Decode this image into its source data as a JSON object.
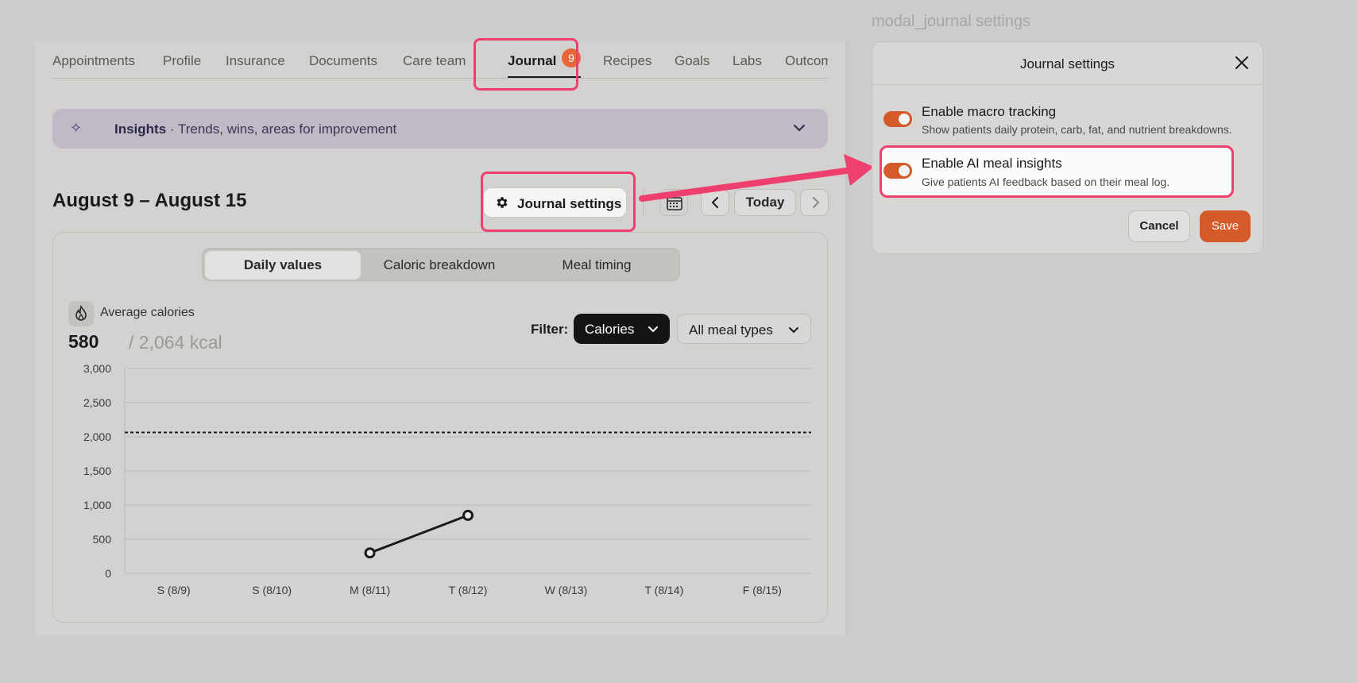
{
  "tabs": [
    {
      "label": "Appointments"
    },
    {
      "label": "Profile"
    },
    {
      "label": "Insurance"
    },
    {
      "label": "Documents"
    },
    {
      "label": "Care team"
    },
    {
      "label": "Journal",
      "badge": "9"
    },
    {
      "label": "Recipes"
    },
    {
      "label": "Goals"
    },
    {
      "label": "Labs"
    },
    {
      "label": "Outcomes"
    }
  ],
  "insights": {
    "bold": "Insights",
    "rest": " · Trends, wins, areas for improvement"
  },
  "week_range": "August 9 – August 15",
  "toolbar": {
    "journal_settings": "Journal settings",
    "today": "Today"
  },
  "segments": [
    "Daily values",
    "Caloric breakdown",
    "Meal timing"
  ],
  "average": {
    "label": "Average calories",
    "value": "580",
    "goal": "/ 2,064 kcal"
  },
  "filter": {
    "label": "Filter:",
    "metric": "Calories",
    "meal": "All meal types"
  },
  "chart_data": {
    "type": "line",
    "categories": [
      "S (8/9)",
      "S (8/10)",
      "M (8/11)",
      "T (8/12)",
      "W (8/13)",
      "T (8/14)",
      "F (8/15)"
    ],
    "series": [
      {
        "values": [
          null,
          null,
          300,
          850,
          null,
          null,
          null
        ]
      }
    ],
    "reference_line": 2064,
    "ylim": [
      0,
      3000
    ],
    "yticks": [
      "0",
      "500",
      "1,000",
      "1,500",
      "2,000",
      "2,500",
      "3,000"
    ],
    "grid": true
  },
  "modal": {
    "caption": "modal_journal settings",
    "title": "Journal settings",
    "options": [
      {
        "title": "Enable macro tracking",
        "desc": "Show patients daily protein, carb, fat, and nutrient breakdowns."
      },
      {
        "title": "Enable AI meal insights",
        "desc": "Give patients AI feedback based on their meal log."
      }
    ],
    "cancel": "Cancel",
    "save": "Save"
  },
  "colors": {
    "accent": "#d45a2a",
    "highlight": "#ee3f6e",
    "badge": "#e8663a"
  }
}
